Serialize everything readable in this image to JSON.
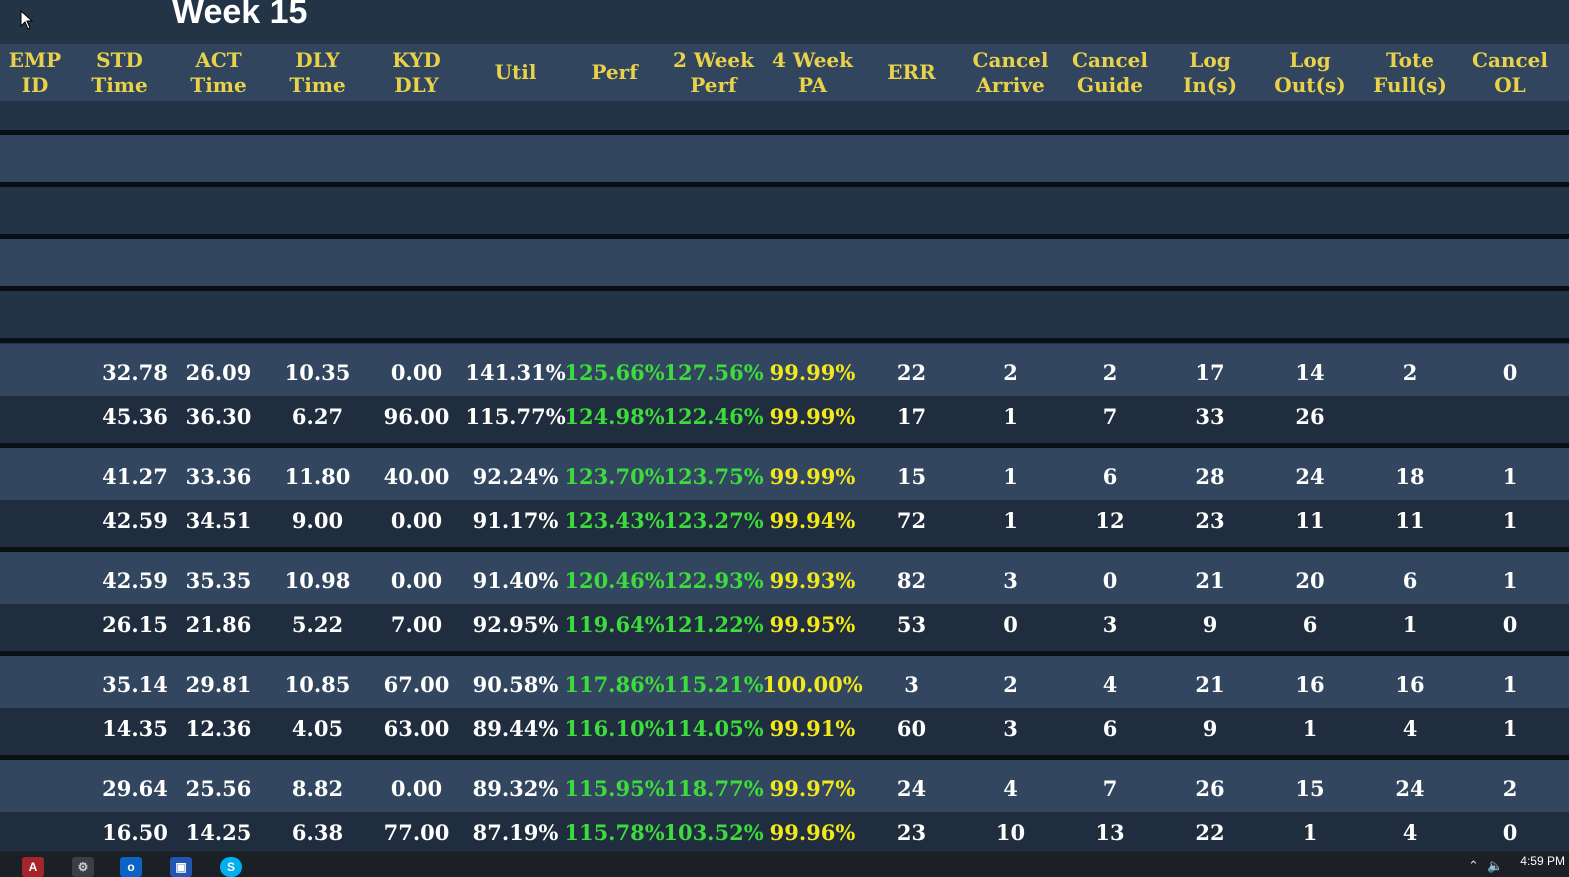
{
  "title": "Week 15",
  "headers": [
    "EMP\nID",
    "STD\nTime",
    "ACT\nTime",
    "DLY\nTime",
    "KYD\nDLY",
    "Util",
    "Perf",
    "2 Week\nPerf",
    "4 Week\nPA",
    "ERR",
    "Cancel\nArrive",
    "Cancel\nGuide",
    "Log\nIn(s)",
    "Log\nOut(s)",
    "Tote\nFull(s)",
    "Cancel\nOL"
  ],
  "rows": [
    [
      "32.78",
      "26.09",
      "10.35",
      "0.00",
      "141.31%",
      "125.66%",
      "127.56%",
      "99.99%",
      "22",
      "2",
      "2",
      "17",
      "14",
      "2",
      "0"
    ],
    [
      "45.36",
      "36.30",
      "6.27",
      "96.00",
      "115.77%",
      "124.98%",
      "122.46%",
      "99.99%",
      "17",
      "1",
      "7",
      "33",
      "26",
      "",
      ""
    ],
    [
      "41.27",
      "33.36",
      "11.80",
      "40.00",
      "92.24%",
      "123.70%",
      "123.75%",
      "99.99%",
      "15",
      "1",
      "6",
      "28",
      "24",
      "18",
      "1"
    ],
    [
      "42.59",
      "34.51",
      "9.00",
      "0.00",
      "91.17%",
      "123.43%",
      "123.27%",
      "99.94%",
      "72",
      "1",
      "12",
      "23",
      "11",
      "11",
      "1"
    ],
    [
      "42.59",
      "35.35",
      "10.98",
      "0.00",
      "91.40%",
      "120.46%",
      "122.93%",
      "99.93%",
      "82",
      "3",
      "0",
      "21",
      "20",
      "6",
      "1"
    ],
    [
      "26.15",
      "21.86",
      "5.22",
      "7.00",
      "92.95%",
      "119.64%",
      "121.22%",
      "99.95%",
      "53",
      "0",
      "3",
      "9",
      "6",
      "1",
      "0"
    ],
    [
      "35.14",
      "29.81",
      "10.85",
      "67.00",
      "90.58%",
      "117.86%",
      "115.21%",
      "100.00%",
      "3",
      "2",
      "4",
      "21",
      "16",
      "16",
      "1"
    ],
    [
      "14.35",
      "12.36",
      "4.05",
      "63.00",
      "89.44%",
      "116.10%",
      "114.05%",
      "99.91%",
      "60",
      "3",
      "6",
      "9",
      "1",
      "4",
      "1"
    ],
    [
      "29.64",
      "25.56",
      "8.82",
      "0.00",
      "89.32%",
      "115.95%",
      "118.77%",
      "99.97%",
      "24",
      "4",
      "7",
      "26",
      "15",
      "24",
      "2"
    ],
    [
      "16.50",
      "14.25",
      "6.38",
      "77.00",
      "87.19%",
      "115.78%",
      "103.52%",
      "99.96%",
      "23",
      "10",
      "13",
      "22",
      "1",
      "4",
      "0"
    ]
  ],
  "colors": {
    "header": "#e9d14a",
    "perf": "#3ddc3d",
    "pa": "#f3e81b"
  },
  "taskbar": {
    "icons": [
      "access-icon",
      "settings-icon",
      "outlook-icon",
      "remote-desktop-icon",
      "skype-icon"
    ],
    "time": "4:59 PM"
  }
}
